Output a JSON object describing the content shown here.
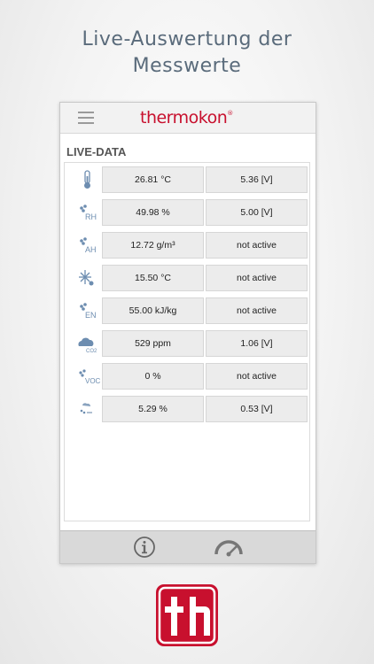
{
  "headline": {
    "line1": "Live-Auswertung der",
    "line2": "Messwerte"
  },
  "app": {
    "brand": "thermokon",
    "brand_mark": "®",
    "section_title": "LIVE-DATA"
  },
  "rows": [
    {
      "icon": "thermometer-icon",
      "value": "26.81 °C",
      "output": "5.36 [V]"
    },
    {
      "icon": "relative-humidity-icon",
      "sub": "RH",
      "value": "49.98 %",
      "output": "5.00 [V]"
    },
    {
      "icon": "absolute-humidity-icon",
      "sub": "AH",
      "value": "12.72 g/m³",
      "output": "not active"
    },
    {
      "icon": "dew-point-icon",
      "value": "15.50 °C",
      "output": "not active"
    },
    {
      "icon": "enthalpy-icon",
      "sub": "EN",
      "value": "55.00 kJ/kg",
      "output": "not active"
    },
    {
      "icon": "co2-icon",
      "sub": "CO2",
      "value": "529 ppm",
      "output": "1.06 [V]"
    },
    {
      "icon": "voc-icon",
      "sub": "VOC",
      "value": "0 %",
      "output": "not active"
    },
    {
      "icon": "air-quality-icon",
      "value": "5.29 %",
      "output": "0.53 [V]"
    }
  ],
  "colors": {
    "brand": "#c8102e",
    "headline": "#5a6b7b",
    "icon": "#6d8db0"
  },
  "logo_text": "th"
}
